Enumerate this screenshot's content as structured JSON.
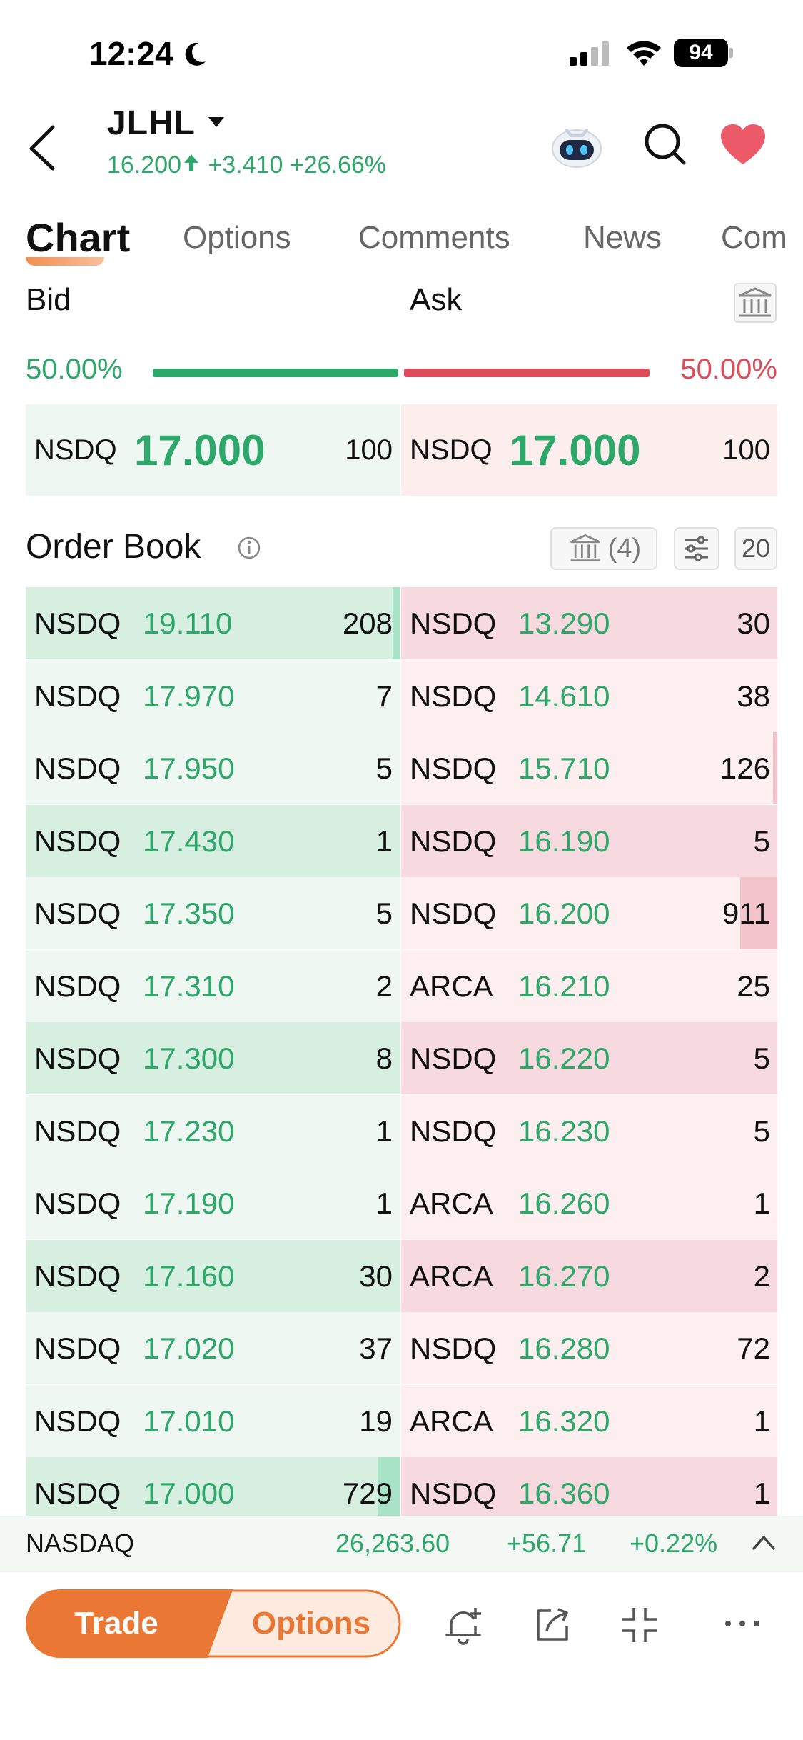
{
  "status_bar": {
    "time": "12:24",
    "battery": "94"
  },
  "header": {
    "ticker": "JLHL",
    "last_price": "16.200",
    "change": "+3.410",
    "change_pct": "+26.66%"
  },
  "tabs": [
    {
      "label": "Chart",
      "active": true
    },
    {
      "label": "Options"
    },
    {
      "label": "Comments"
    },
    {
      "label": "News"
    },
    {
      "label": "Com"
    }
  ],
  "bid_ask": {
    "bid_label": "Bid",
    "ask_label": "Ask",
    "bid_pct": "50.00%",
    "ask_pct": "50.00%",
    "best_bid": {
      "exchange": "NSDQ",
      "price": "17.000",
      "size": "100"
    },
    "best_ask": {
      "exchange": "NSDQ",
      "price": "17.000",
      "size": "100"
    }
  },
  "order_book": {
    "title": "Order Book",
    "bank_count": "(4)",
    "depth": "20",
    "rows": [
      {
        "bid": {
          "ex": "NSDQ",
          "px": "19.110",
          "sz": "208",
          "vol": 0.02
        },
        "ask": {
          "ex": "NSDQ",
          "px": "13.290",
          "sz": "30",
          "vol": 0.0
        }
      },
      {
        "bid": {
          "ex": "NSDQ",
          "px": "17.970",
          "sz": "7",
          "vol": 0.0
        },
        "ask": {
          "ex": "NSDQ",
          "px": "14.610",
          "sz": "38",
          "vol": 0.0
        }
      },
      {
        "bid": {
          "ex": "NSDQ",
          "px": "17.950",
          "sz": "5",
          "vol": 0.0
        },
        "ask": {
          "ex": "NSDQ",
          "px": "15.710",
          "sz": "126",
          "vol": 0.01
        }
      },
      {
        "bid": {
          "ex": "NSDQ",
          "px": "17.430",
          "sz": "1",
          "vol": 0.0
        },
        "ask": {
          "ex": "NSDQ",
          "px": "16.190",
          "sz": "5",
          "vol": 0.0
        }
      },
      {
        "bid": {
          "ex": "NSDQ",
          "px": "17.350",
          "sz": "5",
          "vol": 0.0
        },
        "ask": {
          "ex": "NSDQ",
          "px": "16.200",
          "sz": "911",
          "vol": 0.1
        }
      },
      {
        "bid": {
          "ex": "NSDQ",
          "px": "17.310",
          "sz": "2",
          "vol": 0.0
        },
        "ask": {
          "ex": "ARCA",
          "px": "16.210",
          "sz": "25",
          "vol": 0.0
        }
      },
      {
        "bid": {
          "ex": "NSDQ",
          "px": "17.300",
          "sz": "8",
          "vol": 0.0
        },
        "ask": {
          "ex": "NSDQ",
          "px": "16.220",
          "sz": "5",
          "vol": 0.0
        }
      },
      {
        "bid": {
          "ex": "NSDQ",
          "px": "17.230",
          "sz": "1",
          "vol": 0.0
        },
        "ask": {
          "ex": "NSDQ",
          "px": "16.230",
          "sz": "5",
          "vol": 0.0
        }
      },
      {
        "bid": {
          "ex": "NSDQ",
          "px": "17.190",
          "sz": "1",
          "vol": 0.0
        },
        "ask": {
          "ex": "ARCA",
          "px": "16.260",
          "sz": "1",
          "vol": 0.0
        }
      },
      {
        "bid": {
          "ex": "NSDQ",
          "px": "17.160",
          "sz": "30",
          "vol": 0.0
        },
        "ask": {
          "ex": "ARCA",
          "px": "16.270",
          "sz": "2",
          "vol": 0.0
        }
      },
      {
        "bid": {
          "ex": "NSDQ",
          "px": "17.020",
          "sz": "37",
          "vol": 0.0
        },
        "ask": {
          "ex": "NSDQ",
          "px": "16.280",
          "sz": "72",
          "vol": 0.0
        }
      },
      {
        "bid": {
          "ex": "NSDQ",
          "px": "17.010",
          "sz": "19",
          "vol": 0.0
        },
        "ask": {
          "ex": "ARCA",
          "px": "16.320",
          "sz": "1",
          "vol": 0.0
        }
      },
      {
        "bid": {
          "ex": "NSDQ",
          "px": "17.000",
          "sz": "729",
          "vol": 0.06
        },
        "ask": {
          "ex": "NSDQ",
          "px": "16.360",
          "sz": "1",
          "vol": 0.0
        }
      }
    ]
  },
  "index": {
    "name": "NASDAQ",
    "value": "26,263.60",
    "change": "+56.71",
    "change_pct": "+0.22%"
  },
  "toolbar": {
    "trade_label": "Trade",
    "options_label": "Options"
  },
  "colors": {
    "up": "#2ea86a",
    "down": "#dd4c5a",
    "accent": "#ea7734"
  }
}
